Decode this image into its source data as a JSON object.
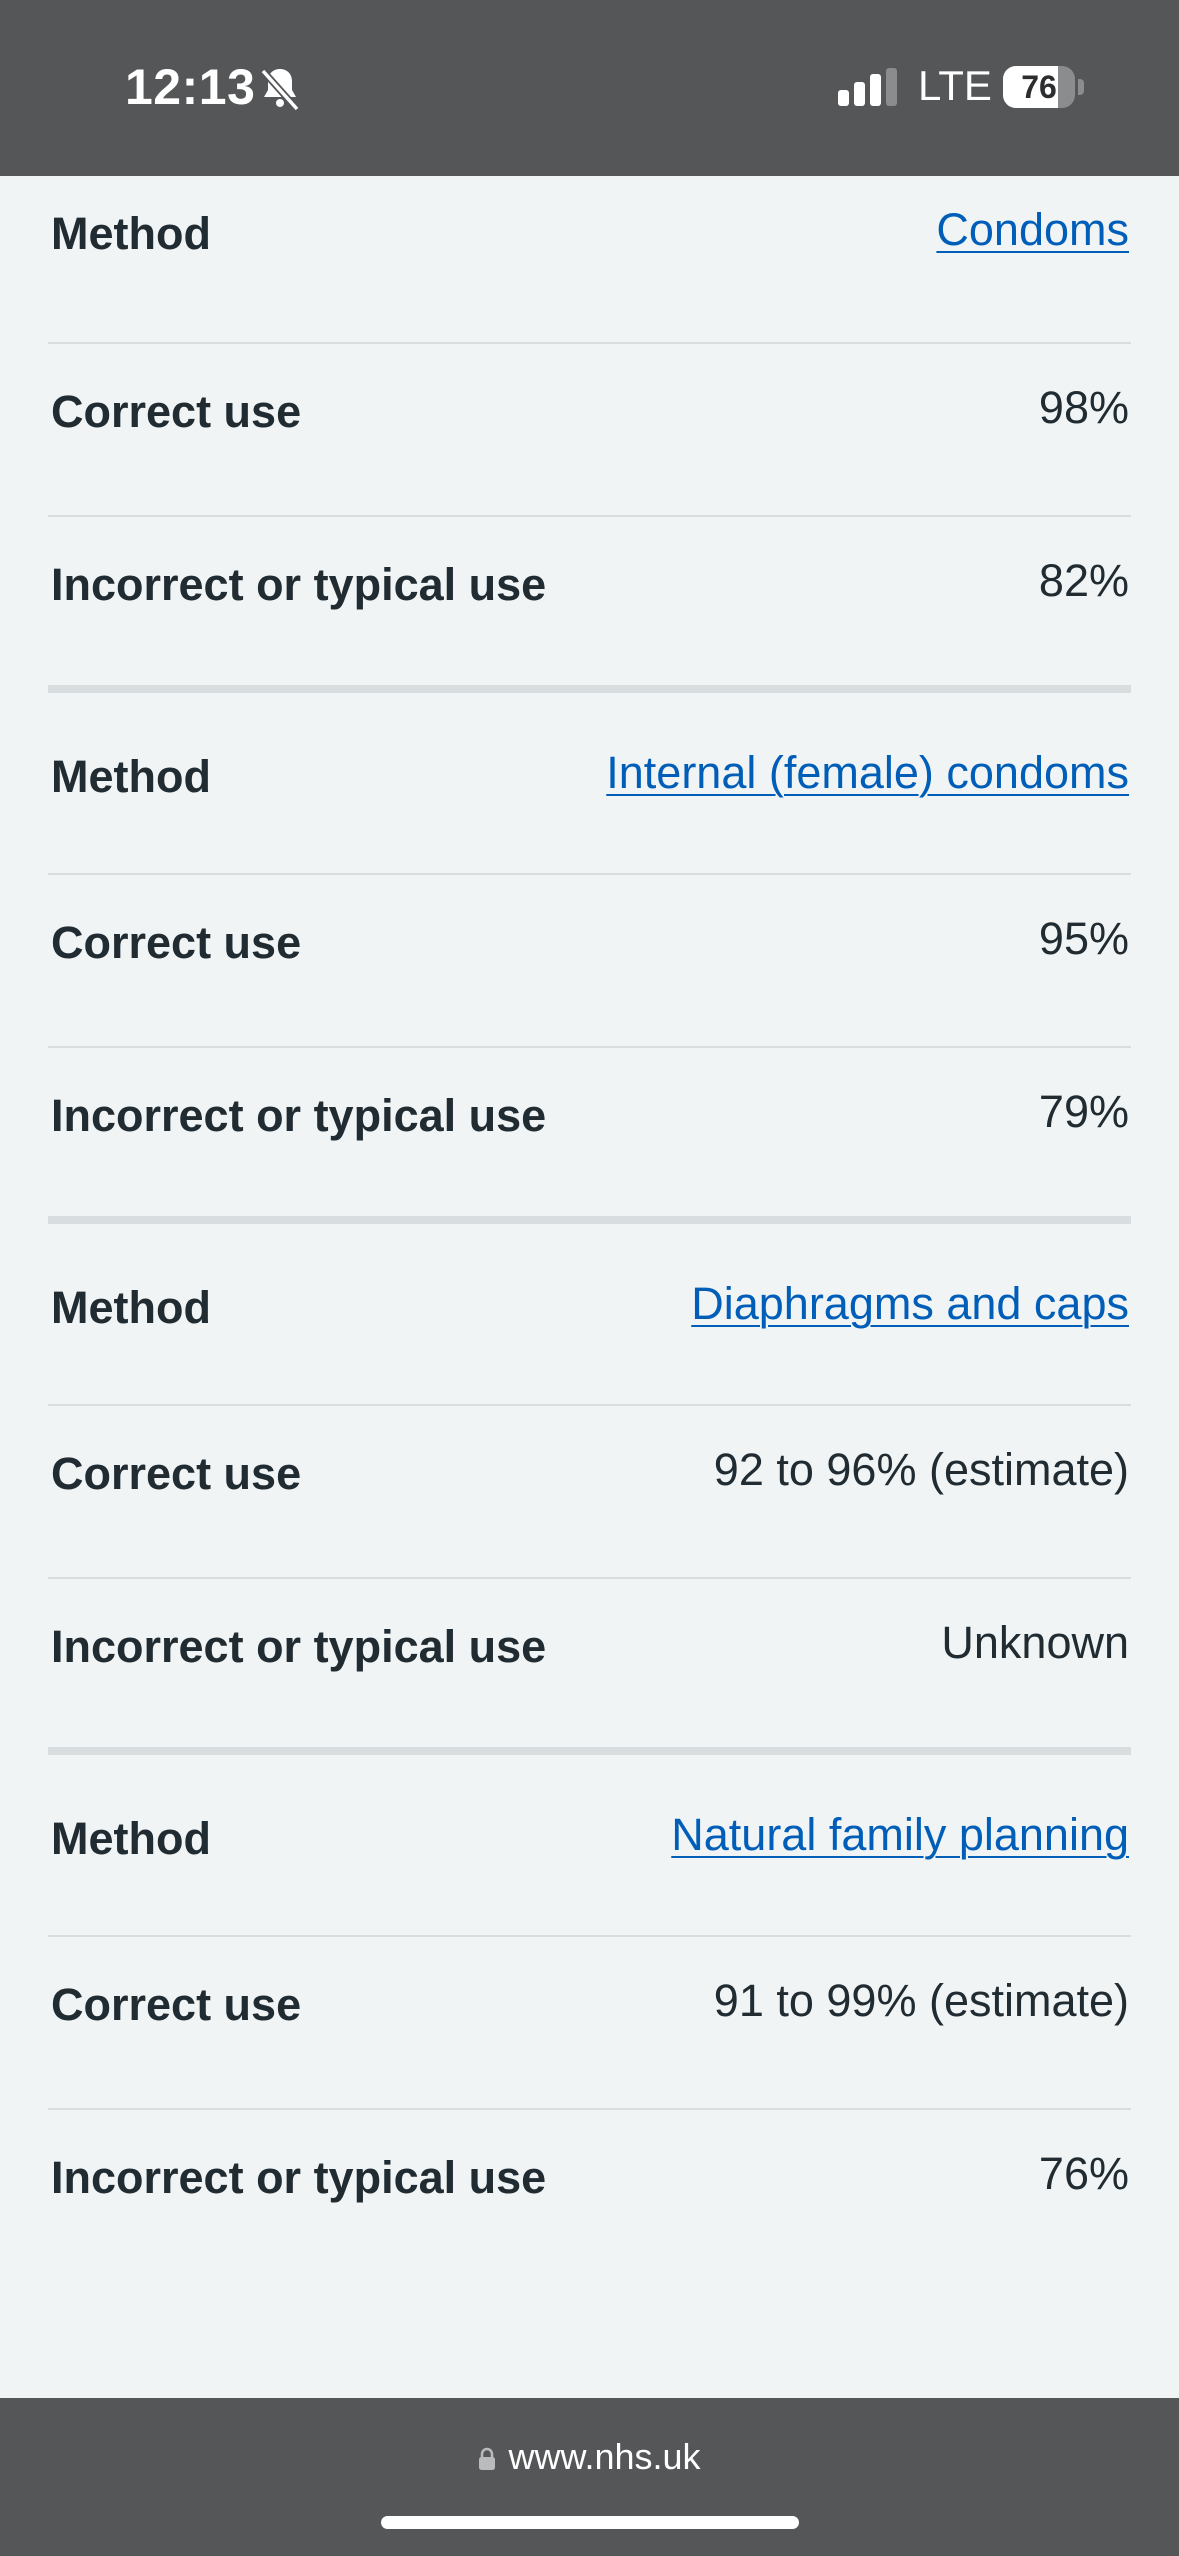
{
  "status_bar": {
    "time": "12:13",
    "network": "LTE",
    "battery_level": "76",
    "icons": [
      "bell-slash-icon",
      "signal-icon",
      "battery-icon"
    ]
  },
  "groups": [
    {
      "method_label": "Method",
      "method_name": "Condoms",
      "correct_label": "Correct use",
      "correct_value": "98%",
      "typical_label": "Incorrect or typical use",
      "typical_value": "82%"
    },
    {
      "method_label": "Method",
      "method_name": "Internal (female) condoms",
      "correct_label": "Correct use",
      "correct_value": "95%",
      "typical_label": "Incorrect or typical use",
      "typical_value": "79%"
    },
    {
      "method_label": "Method",
      "method_name": "Diaphragms and caps",
      "correct_label": "Correct use",
      "correct_value": "92 to 96% (estimate)",
      "typical_label": "Incorrect or typical use",
      "typical_value": "Unknown"
    },
    {
      "method_label": "Method",
      "method_name": "Natural family planning",
      "correct_label": "Correct use",
      "correct_value": "91 to 99% (estimate)",
      "typical_label": "Incorrect or typical use",
      "typical_value": "76%"
    }
  ],
  "browser": {
    "url": "www.nhs.uk"
  },
  "colors": {
    "link": "#005eb8",
    "text": "#212b32",
    "background": "#f0f4f5",
    "chrome": "#545657"
  }
}
